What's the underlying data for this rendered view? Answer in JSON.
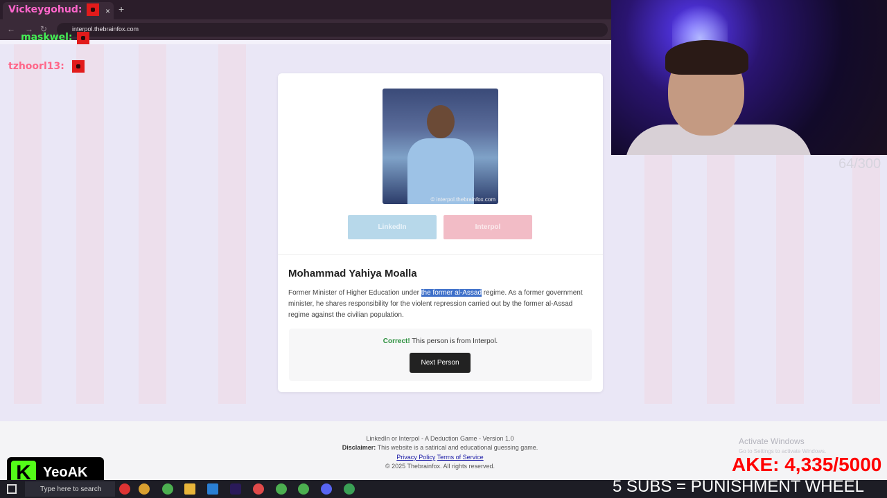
{
  "browser": {
    "tab_close": "×",
    "new_tab": "+",
    "back": "←",
    "forward": "→",
    "reload": "↻",
    "url": "interpol.thebrainfox.com"
  },
  "overlays": {
    "user1": "Vickeygohud:",
    "user2": "maskwel:",
    "user3": "tzhoorl13:",
    "counter": "64/300",
    "stake": "AKE: 4,335/5000",
    "ticker": "5 SUBS = PUNISHMENT WHEEL",
    "kick_logo": "K",
    "kick_name": "YeoAK",
    "colors": {
      "user1": "#ff66cc",
      "user2": "#44ee55",
      "user3": "#ff6688",
      "stake": "#ff0000"
    }
  },
  "card": {
    "image_watermark": "© interpol.thebrainfox.com",
    "linkedin_label": "LinkedIn",
    "interpol_label": "Interpol",
    "person_name": "Mohammad Yahiya Moalla",
    "desc_before": "Former Minister of Higher Education under ",
    "desc_highlight": "the former al-Assad",
    "desc_after": " regime. As a former government minister, he shares responsibility for the violent repression carried out by the former al-Assad regime against the civilian population.",
    "result_status": "Correct!",
    "result_message": " This person is from Interpol.",
    "next_button": "Next Person"
  },
  "footer": {
    "line1": "LinkedIn or Interpol - A Deduction Game - Version 1.0",
    "disclaimer_label": "Disclaimer:",
    "disclaimer_text": " This website is a satirical and educational guessing game.",
    "privacy": "Privacy Policy",
    "terms": "Terms of Service",
    "copyright": "© 2025 Thebrainfox. All rights reserved."
  },
  "windows": {
    "activate_title": "Activate Windows",
    "activate_sub": "Go to Settings to activate Windows.",
    "search_placeholder": "Type here to search"
  }
}
